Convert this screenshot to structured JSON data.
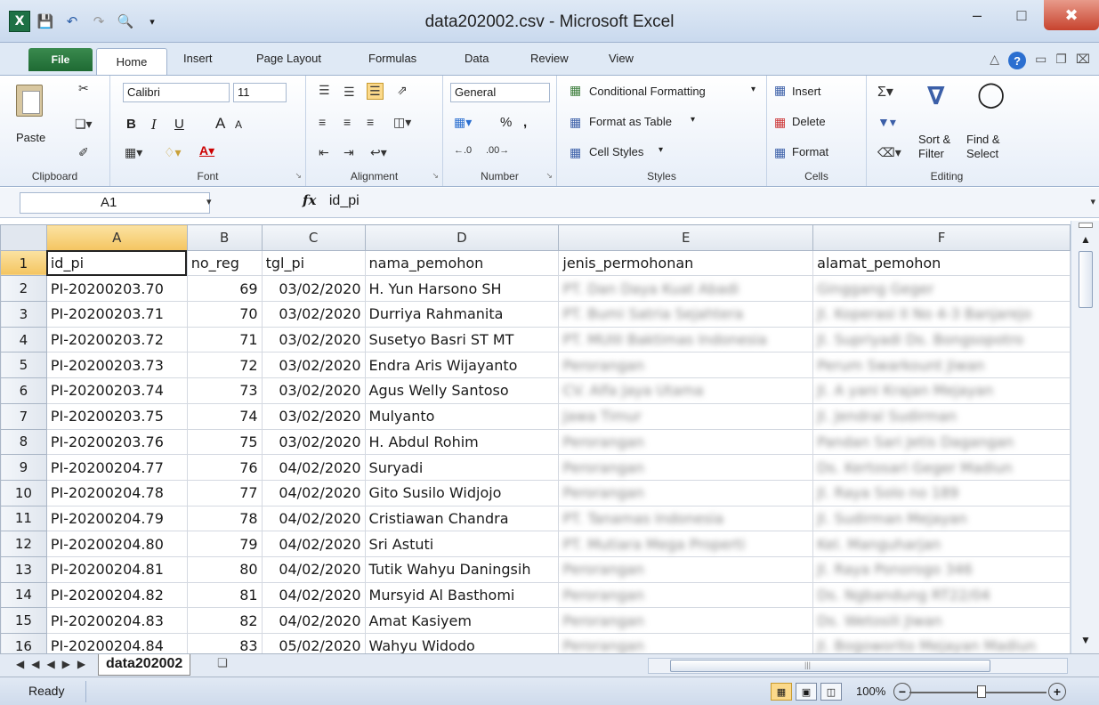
{
  "window": {
    "title": "data202002.csv - Microsoft Excel",
    "app_icon": "excel-icon",
    "minimize": "‒",
    "maximize": "□",
    "close": "✖"
  },
  "tabs": {
    "file": "File",
    "home": "Home",
    "insert": "Insert",
    "page_layout": "Page Layout",
    "formulas": "Formulas",
    "data": "Data",
    "review": "Review",
    "view": "View"
  },
  "ribbon": {
    "clipboard": {
      "label": "Clipboard",
      "paste": "Paste"
    },
    "font": {
      "label": "Font",
      "name": "Calibri",
      "size": "11",
      "bold": "B",
      "italic": "I",
      "underline": "U",
      "grow": "A",
      "shrink": "A"
    },
    "alignment": {
      "label": "Alignment"
    },
    "number": {
      "label": "Number",
      "format": "General",
      "percent": "%",
      "comma": ","
    },
    "styles": {
      "label": "Styles",
      "conditional": "Conditional Formatting",
      "format_table": "Format as Table",
      "cell_styles": "Cell Styles"
    },
    "cells": {
      "label": "Cells",
      "insert": "Insert",
      "delete": "Delete",
      "format": "Format"
    },
    "editing": {
      "label": "Editing",
      "sort": "Sort &",
      "filter": "Filter",
      "find": "Find &",
      "select": "Select"
    }
  },
  "formula_bar": {
    "name_box": "A1",
    "fx": "fx",
    "content": "id_pi"
  },
  "columns": [
    "A",
    "B",
    "C",
    "D",
    "E",
    "F"
  ],
  "header_row": {
    "num": "1",
    "a": "id_pi",
    "b": "no_reg",
    "c": "tgl_pi",
    "d": "nama_pemohon",
    "e": "jenis_permohonan",
    "f": "alamat_pemohon"
  },
  "rows": [
    {
      "num": "2",
      "a": "PI-20200203.70",
      "b": "69",
      "c": "03/02/2020",
      "d": "H. Yun Harsono SH",
      "e": "PT. Dan Daya Kuat Abadi",
      "f": "Ginggang Geger"
    },
    {
      "num": "3",
      "a": "PI-20200203.71",
      "b": "70",
      "c": "03/02/2020",
      "d": "Durriya Rahmanita",
      "e": "PT. Bumi Satria Sejahtera",
      "f": "Jl. Koperasi II No 4-3 Banjarejo"
    },
    {
      "num": "4",
      "a": "PI-20200203.72",
      "b": "71",
      "c": "03/02/2020",
      "d": "Susetyo Basri ST MT",
      "e": "PT. MUIII Baktimas Indonesia",
      "f": "Jl. Supriyadi Ds. Bongsopotro"
    },
    {
      "num": "5",
      "a": "PI-20200203.73",
      "b": "72",
      "c": "03/02/2020",
      "d": "Endra Aris Wijayanto",
      "e": "Perorangan",
      "f": "Perum Swarkount Jiwan"
    },
    {
      "num": "6",
      "a": "PI-20200203.74",
      "b": "73",
      "c": "03/02/2020",
      "d": "Agus Welly Santoso",
      "e": "CV. Alfa Jaya Utama",
      "f": "Jl. A yani Krajan Mejayan"
    },
    {
      "num": "7",
      "a": "PI-20200203.75",
      "b": "74",
      "c": "03/02/2020",
      "d": "Mulyanto",
      "e": "Jawa Timur",
      "f": "Jl. Jendral Sudirman"
    },
    {
      "num": "8",
      "a": "PI-20200203.76",
      "b": "75",
      "c": "03/02/2020",
      "d": "H. Abdul Rohim",
      "e": "Perorangan",
      "f": "Pandan Sari Jetis Dagangan"
    },
    {
      "num": "9",
      "a": "PI-20200204.77",
      "b": "76",
      "c": "04/02/2020",
      "d": "Suryadi",
      "e": "Perorangan",
      "f": "Ds. Kertosari Geger Madiun"
    },
    {
      "num": "10",
      "a": "PI-20200204.78",
      "b": "77",
      "c": "04/02/2020",
      "d": "Gito Susilo Widjojo",
      "e": "Perorangan",
      "f": "Jl. Raya Solo no 189"
    },
    {
      "num": "11",
      "a": "PI-20200204.79",
      "b": "78",
      "c": "04/02/2020",
      "d": "Cristiawan Chandra",
      "e": "PT. Tanamas Indonesia",
      "f": "Jl. Sudirman Mejayan"
    },
    {
      "num": "12",
      "a": "PI-20200204.80",
      "b": "79",
      "c": "04/02/2020",
      "d": "Sri Astuti",
      "e": "PT. Mutiara Mega Properti",
      "f": "Kel. Manguharjan"
    },
    {
      "num": "13",
      "a": "PI-20200204.81",
      "b": "80",
      "c": "04/02/2020",
      "d": "Tutik Wahyu Daningsih",
      "e": "Perorangan",
      "f": "Jl. Raya Ponorogo 346"
    },
    {
      "num": "14",
      "a": "PI-20200204.82",
      "b": "81",
      "c": "04/02/2020",
      "d": "Mursyid Al Basthomi",
      "e": "Perorangan",
      "f": "Ds. Ngbandung RT22/04"
    },
    {
      "num": "15",
      "a": "PI-20200204.83",
      "b": "82",
      "c": "04/02/2020",
      "d": "Amat Kasiyem",
      "e": "Perorangan",
      "f": "Ds. Wetosili Jiwan"
    },
    {
      "num": "16",
      "a": "PI-20200204.84",
      "b": "83",
      "c": "05/02/2020",
      "d": "Wahyu Widodo",
      "e": "Perorangan",
      "f": "Jl. Bogoworito Mejayan Madiun"
    }
  ],
  "sheet_tab": "data202002",
  "status": {
    "ready": "Ready",
    "zoom": "100%"
  }
}
